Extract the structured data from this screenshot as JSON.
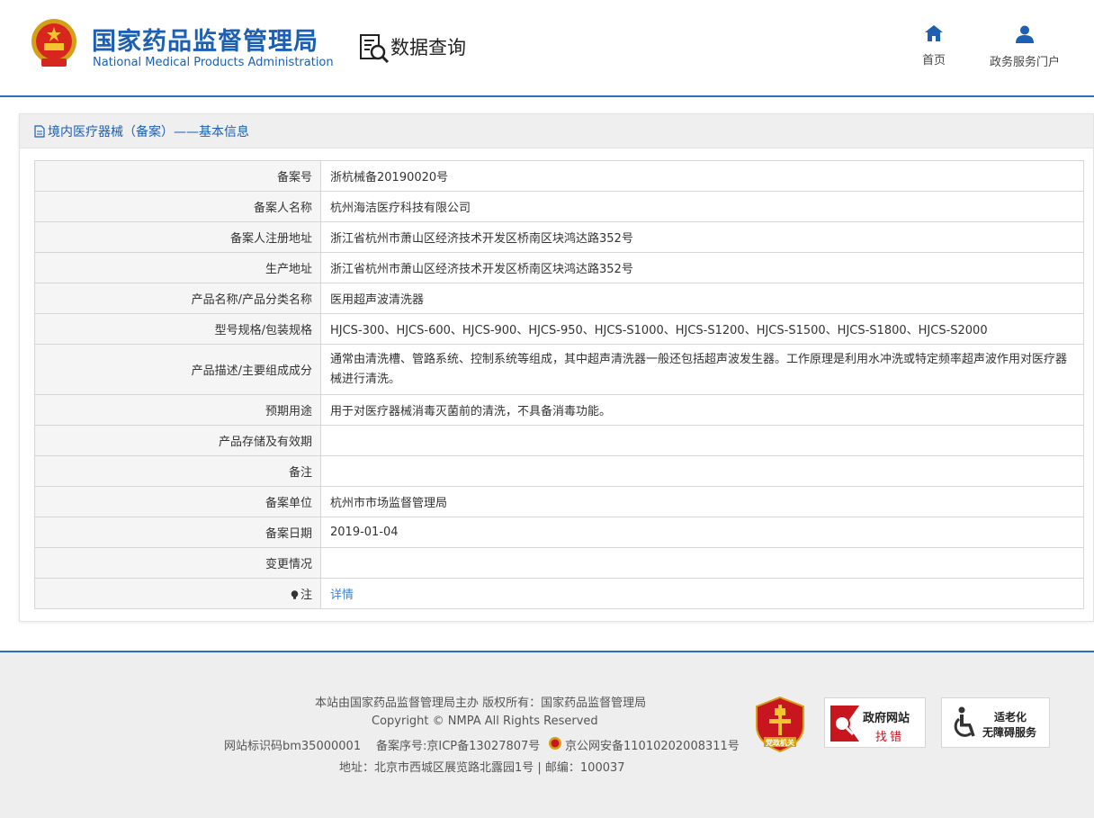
{
  "header": {
    "org_name_cn": "国家药品监督管理局",
    "org_name_en": "National Medical Products Administration",
    "query_title": "数据查询",
    "nav": {
      "home_label": "首页",
      "portal_label": "政务服务门户"
    }
  },
  "panel": {
    "title": "境内医疗器械（备案）——基本信息",
    "rows": [
      {
        "label": "备案号",
        "value": "浙杭械备20190020号"
      },
      {
        "label": "备案人名称",
        "value": "杭州海洁医疗科技有限公司"
      },
      {
        "label": "备案人注册地址",
        "value": "浙江省杭州市萧山区经济技术开发区桥南区块鸿达路352号"
      },
      {
        "label": "生产地址",
        "value": "浙江省杭州市萧山区经济技术开发区桥南区块鸿达路352号"
      },
      {
        "label": "产品名称/产品分类名称",
        "value": "医用超声波清洗器"
      },
      {
        "label": "型号规格/包装规格",
        "value": "HJCS-300、HJCS-600、HJCS-900、HJCS-950、HJCS-S1000、HJCS-S1200、HJCS-S1500、HJCS-S1800、HJCS-S2000"
      },
      {
        "label": "产品描述/主要组成成分",
        "value": "通常由清洗槽、管路系统、控制系统等组成，其中超声清洗器一般还包括超声波发生器。工作原理是利用水冲洗或特定频率超声波作用对医疗器械进行清洗。"
      },
      {
        "label": "预期用途",
        "value": "用于对医疗器械消毒灭菌前的清洗，不具备消毒功能。"
      },
      {
        "label": "产品存储及有效期",
        "value": ""
      },
      {
        "label": "备注",
        "value": ""
      },
      {
        "label": "备案单位",
        "value": "杭州市市场监督管理局"
      },
      {
        "label": "备案日期",
        "value": "2019-01-04"
      },
      {
        "label": "变更情况",
        "value": ""
      }
    ],
    "note_label": "注",
    "note_link": "详情"
  },
  "footer": {
    "line1": "本站由国家药品监督管理局主办 版权所有：国家药品监督管理局",
    "line2": "Copyright © NMPA All Rights Reserved",
    "site_id": "网站标识码bm35000001",
    "icp": "备案序号:京ICP备13027807号",
    "police": "京公网安备11010202008311号",
    "address": "地址：北京市西城区展览路北露园1号 | 邮编：100037",
    "badges": {
      "party": "党政机关",
      "gov_error_1": "政府网站",
      "gov_error_2": "找错",
      "access_1": "适老化",
      "access_2": "无障碍服务"
    }
  },
  "colors": {
    "brand_blue": "#1c5fb3",
    "link_blue": "#3a83d3",
    "label_bg": "#f5f5f5",
    "footer_bg": "#eeeeee"
  }
}
